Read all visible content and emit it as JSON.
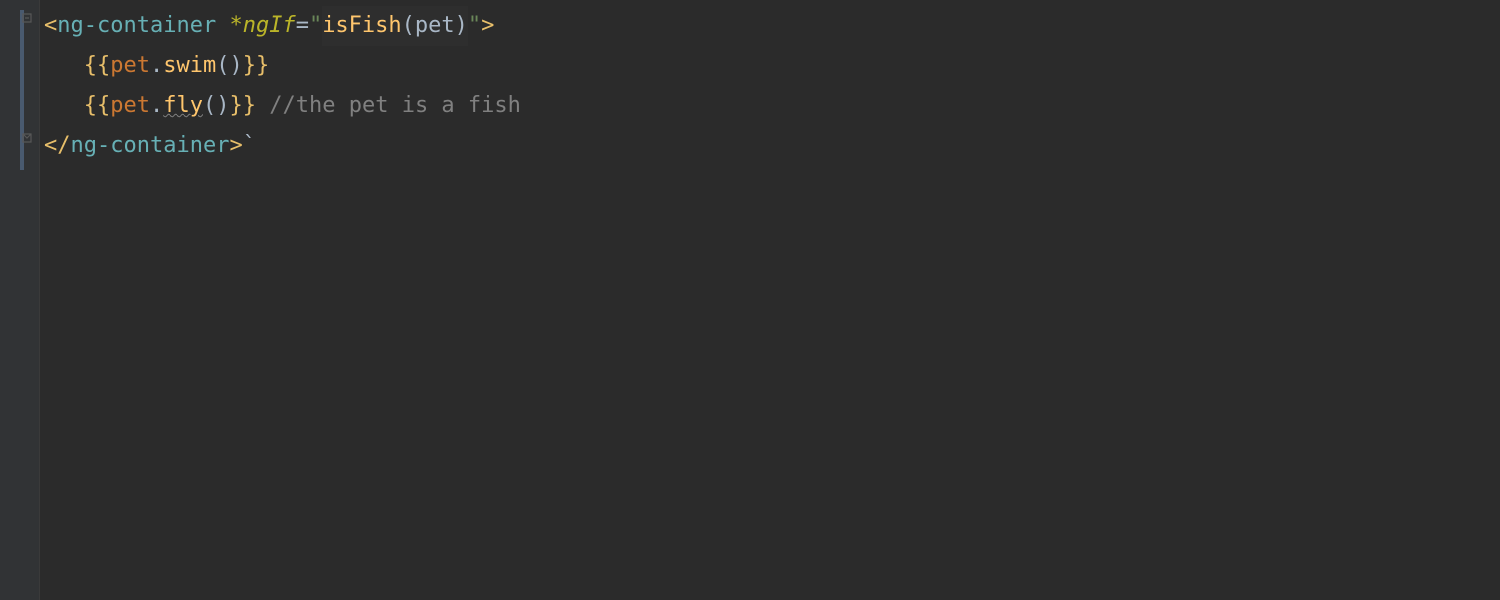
{
  "line1": {
    "open_bracket": "<",
    "tag": "ng-container",
    "space": " ",
    "attr": "*ngIf",
    "equal": "=",
    "quote1": "\"",
    "fn": "isFish",
    "paren_open": "(",
    "arg": "pet",
    "paren_close": ")",
    "quote2": "\"",
    "close_bracket": ">"
  },
  "line2": {
    "indent": "   ",
    "brace_open": "{{",
    "obj": "pet",
    "dot": ".",
    "method": "swim",
    "parens": "()",
    "brace_close": "}}"
  },
  "line3": {
    "indent": "   ",
    "brace_open": "{{",
    "obj": "pet",
    "dot": ".",
    "method": "fly",
    "parens": "()",
    "brace_close": "}}",
    "space": " ",
    "comment": "//the pet is a fish"
  },
  "line4": {
    "open_bracket": "</",
    "tag": "ng-container",
    "close_bracket": ">",
    "backtick": "`"
  }
}
